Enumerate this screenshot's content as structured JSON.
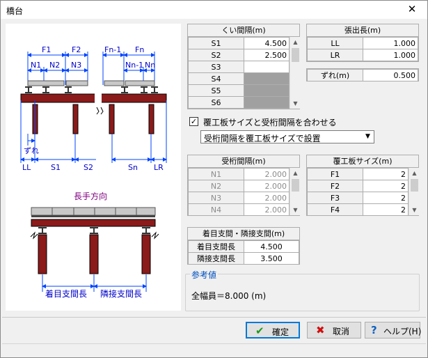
{
  "window": {
    "title": "橋台",
    "close_glyph": "✕"
  },
  "diagram": {
    "top_labels": {
      "f1": "F1",
      "f2": "F2",
      "fn1": "Fn-1",
      "fn": "Fn",
      "n1": "N1",
      "n2": "N2",
      "n3": "N3",
      "nn1": "Nn-1",
      "nn": "Nn"
    },
    "bottom_labels": {
      "ll": "LL",
      "s1": "S1",
      "s2": "S2",
      "sn": "Sn",
      "lr": "LR",
      "zure": "ずれ"
    },
    "long_title": "長手方向",
    "long_labels": {
      "main": "着目支間長",
      "adj": "隣接支間長"
    }
  },
  "pile_spacing": {
    "title": "くい間隔(m)",
    "rows": [
      {
        "label": "S1",
        "value": "4.500"
      },
      {
        "label": "S2",
        "value": "2.500"
      },
      {
        "label": "S3",
        "value": ""
      },
      {
        "label": "S4",
        "value": ""
      },
      {
        "label": "S5",
        "value": ""
      },
      {
        "label": "S6",
        "value": ""
      }
    ]
  },
  "overhang": {
    "title": "張出長(m)",
    "rows": [
      {
        "label": "LL",
        "value": "1.000"
      },
      {
        "label": "LR",
        "value": "1.000"
      }
    ]
  },
  "offset": {
    "label": "ずれ(m)",
    "value": "0.500"
  },
  "match_checkbox": {
    "checked": "✓",
    "label": "覆工板サイズと受桁間隔を合わせる"
  },
  "match_select": {
    "value": "受桁間隔を覆工板サイズで設置"
  },
  "girder_spacing": {
    "title": "受桁間隔(m)",
    "rows": [
      {
        "label": "N1",
        "value": "2.000"
      },
      {
        "label": "N2",
        "value": "2.000"
      },
      {
        "label": "N3",
        "value": "2.000"
      },
      {
        "label": "N4",
        "value": "2.000"
      }
    ]
  },
  "plate_size": {
    "title": "覆工板サイズ(m)",
    "rows": [
      {
        "label": "F1",
        "value": "2"
      },
      {
        "label": "F2",
        "value": "2"
      },
      {
        "label": "F3",
        "value": "2"
      },
      {
        "label": "F4",
        "value": "2"
      }
    ]
  },
  "span": {
    "title": "着目支間・隣接支間(m)",
    "rows": [
      {
        "label": "着目支間長",
        "value": "4.500"
      },
      {
        "label": "隣接支間長",
        "value": "3.500"
      }
    ]
  },
  "reference": {
    "title": "参考値",
    "text": "全幅員＝8.000 (m)"
  },
  "buttons": {
    "ok": {
      "label": "確定",
      "icon": "✔"
    },
    "cancel": {
      "label": "取消",
      "icon": "✖"
    },
    "help": {
      "label": "ヘルプ(H)",
      "icon": "?"
    }
  },
  "colors": {
    "beam": "#8b1a1a",
    "dim": "#0044ff",
    "label_dim": "#0000cc",
    "title_purple": "#800080"
  }
}
